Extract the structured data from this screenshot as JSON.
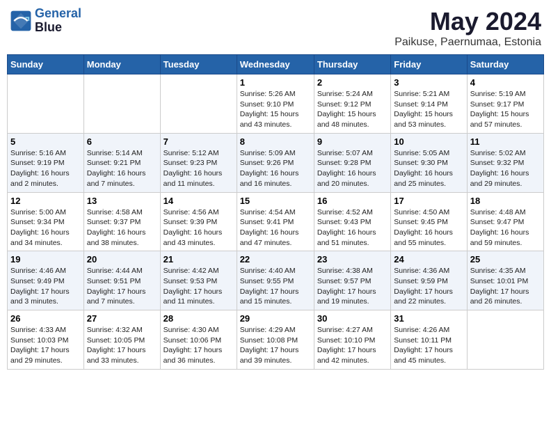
{
  "header": {
    "logo_line1": "General",
    "logo_line2": "Blue",
    "title": "May 2024",
    "subtitle": "Paikuse, Paernumaa, Estonia"
  },
  "days_of_week": [
    "Sunday",
    "Monday",
    "Tuesday",
    "Wednesday",
    "Thursday",
    "Friday",
    "Saturday"
  ],
  "weeks": [
    [
      {
        "day": "",
        "info": ""
      },
      {
        "day": "",
        "info": ""
      },
      {
        "day": "",
        "info": ""
      },
      {
        "day": "1",
        "info": "Sunrise: 5:26 AM\nSunset: 9:10 PM\nDaylight: 15 hours\nand 43 minutes."
      },
      {
        "day": "2",
        "info": "Sunrise: 5:24 AM\nSunset: 9:12 PM\nDaylight: 15 hours\nand 48 minutes."
      },
      {
        "day": "3",
        "info": "Sunrise: 5:21 AM\nSunset: 9:14 PM\nDaylight: 15 hours\nand 53 minutes."
      },
      {
        "day": "4",
        "info": "Sunrise: 5:19 AM\nSunset: 9:17 PM\nDaylight: 15 hours\nand 57 minutes."
      }
    ],
    [
      {
        "day": "5",
        "info": "Sunrise: 5:16 AM\nSunset: 9:19 PM\nDaylight: 16 hours\nand 2 minutes."
      },
      {
        "day": "6",
        "info": "Sunrise: 5:14 AM\nSunset: 9:21 PM\nDaylight: 16 hours\nand 7 minutes."
      },
      {
        "day": "7",
        "info": "Sunrise: 5:12 AM\nSunset: 9:23 PM\nDaylight: 16 hours\nand 11 minutes."
      },
      {
        "day": "8",
        "info": "Sunrise: 5:09 AM\nSunset: 9:26 PM\nDaylight: 16 hours\nand 16 minutes."
      },
      {
        "day": "9",
        "info": "Sunrise: 5:07 AM\nSunset: 9:28 PM\nDaylight: 16 hours\nand 20 minutes."
      },
      {
        "day": "10",
        "info": "Sunrise: 5:05 AM\nSunset: 9:30 PM\nDaylight: 16 hours\nand 25 minutes."
      },
      {
        "day": "11",
        "info": "Sunrise: 5:02 AM\nSunset: 9:32 PM\nDaylight: 16 hours\nand 29 minutes."
      }
    ],
    [
      {
        "day": "12",
        "info": "Sunrise: 5:00 AM\nSunset: 9:34 PM\nDaylight: 16 hours\nand 34 minutes."
      },
      {
        "day": "13",
        "info": "Sunrise: 4:58 AM\nSunset: 9:37 PM\nDaylight: 16 hours\nand 38 minutes."
      },
      {
        "day": "14",
        "info": "Sunrise: 4:56 AM\nSunset: 9:39 PM\nDaylight: 16 hours\nand 43 minutes."
      },
      {
        "day": "15",
        "info": "Sunrise: 4:54 AM\nSunset: 9:41 PM\nDaylight: 16 hours\nand 47 minutes."
      },
      {
        "day": "16",
        "info": "Sunrise: 4:52 AM\nSunset: 9:43 PM\nDaylight: 16 hours\nand 51 minutes."
      },
      {
        "day": "17",
        "info": "Sunrise: 4:50 AM\nSunset: 9:45 PM\nDaylight: 16 hours\nand 55 minutes."
      },
      {
        "day": "18",
        "info": "Sunrise: 4:48 AM\nSunset: 9:47 PM\nDaylight: 16 hours\nand 59 minutes."
      }
    ],
    [
      {
        "day": "19",
        "info": "Sunrise: 4:46 AM\nSunset: 9:49 PM\nDaylight: 17 hours\nand 3 minutes."
      },
      {
        "day": "20",
        "info": "Sunrise: 4:44 AM\nSunset: 9:51 PM\nDaylight: 17 hours\nand 7 minutes."
      },
      {
        "day": "21",
        "info": "Sunrise: 4:42 AM\nSunset: 9:53 PM\nDaylight: 17 hours\nand 11 minutes."
      },
      {
        "day": "22",
        "info": "Sunrise: 4:40 AM\nSunset: 9:55 PM\nDaylight: 17 hours\nand 15 minutes."
      },
      {
        "day": "23",
        "info": "Sunrise: 4:38 AM\nSunset: 9:57 PM\nDaylight: 17 hours\nand 19 minutes."
      },
      {
        "day": "24",
        "info": "Sunrise: 4:36 AM\nSunset: 9:59 PM\nDaylight: 17 hours\nand 22 minutes."
      },
      {
        "day": "25",
        "info": "Sunrise: 4:35 AM\nSunset: 10:01 PM\nDaylight: 17 hours\nand 26 minutes."
      }
    ],
    [
      {
        "day": "26",
        "info": "Sunrise: 4:33 AM\nSunset: 10:03 PM\nDaylight: 17 hours\nand 29 minutes."
      },
      {
        "day": "27",
        "info": "Sunrise: 4:32 AM\nSunset: 10:05 PM\nDaylight: 17 hours\nand 33 minutes."
      },
      {
        "day": "28",
        "info": "Sunrise: 4:30 AM\nSunset: 10:06 PM\nDaylight: 17 hours\nand 36 minutes."
      },
      {
        "day": "29",
        "info": "Sunrise: 4:29 AM\nSunset: 10:08 PM\nDaylight: 17 hours\nand 39 minutes."
      },
      {
        "day": "30",
        "info": "Sunrise: 4:27 AM\nSunset: 10:10 PM\nDaylight: 17 hours\nand 42 minutes."
      },
      {
        "day": "31",
        "info": "Sunrise: 4:26 AM\nSunset: 10:11 PM\nDaylight: 17 hours\nand 45 minutes."
      },
      {
        "day": "",
        "info": ""
      }
    ]
  ]
}
